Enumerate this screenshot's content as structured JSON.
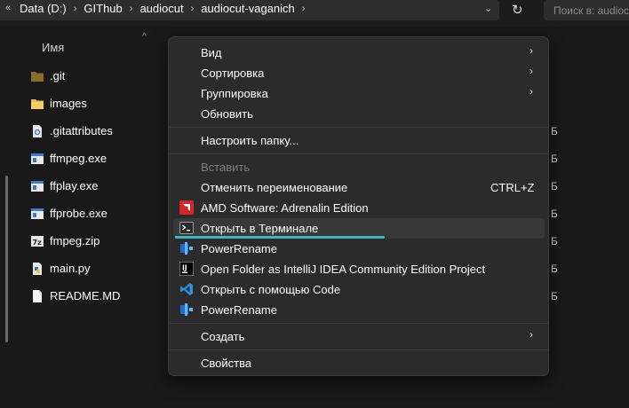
{
  "address_bar": {
    "crumbs": [
      "Data (D:)",
      "GIThub",
      "audiocut",
      "audiocut-vaganich"
    ],
    "search_placeholder": "Поиск в: audiocut"
  },
  "list": {
    "header_name": "Имя",
    "files": [
      {
        "name": ".git",
        "icon": "folder-dark-icon",
        "size_unit": ""
      },
      {
        "name": "images",
        "icon": "folder-icon",
        "size_unit": ""
      },
      {
        "name": ".gitattributes",
        "icon": "settings-file-icon",
        "size_unit": "Б"
      },
      {
        "name": "ffmpeg.exe",
        "icon": "exe-icon",
        "size_unit": "Б"
      },
      {
        "name": "ffplay.exe",
        "icon": "exe-icon",
        "size_unit": "Б"
      },
      {
        "name": "ffprobe.exe",
        "icon": "exe-icon",
        "size_unit": "Б"
      },
      {
        "name": "fmpeg.zip",
        "icon": "zip-icon",
        "size_unit": "Б"
      },
      {
        "name": "main.py",
        "icon": "python-file-icon",
        "size_unit": "Б"
      },
      {
        "name": "README.MD",
        "icon": "text-file-icon",
        "size_unit": "Б"
      }
    ]
  },
  "context_menu": {
    "view": "Вид",
    "sort": "Сортировка",
    "group": "Группировка",
    "refresh": "Обновить",
    "customize": "Настроить папку...",
    "paste": "Вставить",
    "undo_rename": "Отменить переименование",
    "undo_shortcut": "CTRL+Z",
    "amd": "AMD Software: Adrenalin Edition",
    "open_terminal": "Открыть в Терминале",
    "powerrename_1": "PowerRename",
    "intellij": "Open Folder as IntelliJ IDEA Community Edition Project",
    "open_code": "Открыть с помощью Code",
    "powerrename_2": "PowerRename",
    "create": "Создать",
    "properties": "Свойства"
  },
  "colors": {
    "background": "#191919",
    "menu_bg": "#2b2b2b",
    "accent_underline": "#3fb6c6",
    "folder_yellow": "#f0c14b"
  }
}
